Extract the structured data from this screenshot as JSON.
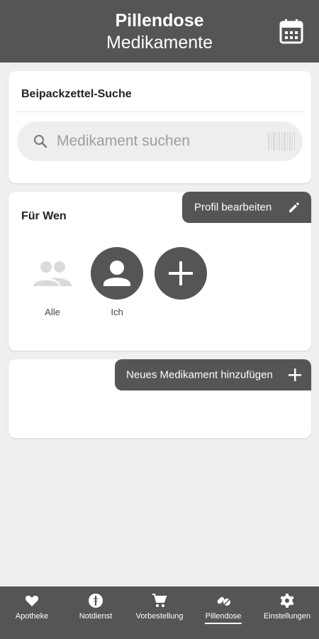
{
  "header": {
    "title": "Pillendose",
    "subtitle": "Medikamente",
    "calendar_icon": "calendar-icon"
  },
  "search_card": {
    "title": "Beipackzettel-Suche",
    "search_placeholder": "Medikament suchen",
    "search_icon": "search-icon",
    "barcode_icon": "barcode-scan-icon"
  },
  "who_card": {
    "title": "Für Wen",
    "edit_button_label": "Profil bearbeiten",
    "edit_icon": "pencil-icon",
    "profiles": [
      {
        "label": "Alle",
        "icon": "group-icon"
      },
      {
        "label": "Ich",
        "icon": "person-icon"
      }
    ],
    "add_profile_icon": "plus-icon"
  },
  "meds_card": {
    "add_button_label": "Neues Medikament hinzufügen",
    "add_icon": "plus-icon"
  },
  "bottom_nav": {
    "items": [
      {
        "label": "Apotheke",
        "icon": "heart-icon",
        "active": false
      },
      {
        "label": "Notdienst",
        "icon": "emergency-icon",
        "active": false
      },
      {
        "label": "Vorbestellung",
        "icon": "cart-icon",
        "active": false
      },
      {
        "label": "Pillendose",
        "icon": "pills-icon",
        "active": true
      },
      {
        "label": "Einstellungen",
        "icon": "gear-icon",
        "active": false
      }
    ]
  },
  "colors": {
    "header_bg": "#555555",
    "page_bg": "#efefef",
    "card_bg": "#ffffff",
    "search_bg": "#eeeeee",
    "placeholder": "#9e9e9e"
  }
}
